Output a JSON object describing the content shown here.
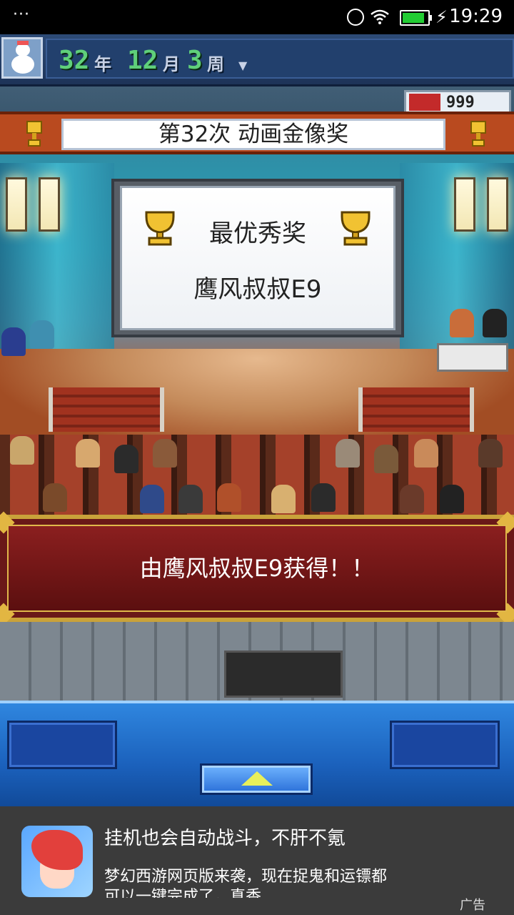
{
  "status_bar": {
    "notification": "···",
    "time": "19:29"
  },
  "hud": {
    "year": "32",
    "year_unit": "年",
    "month": "12",
    "month_unit": "月",
    "week": "3",
    "week_unit": "周",
    "score": "999"
  },
  "banner": {
    "title": "第32次 动画金像奖"
  },
  "screen": {
    "award": "最优秀奖",
    "winner": "鹰风叔叔E9"
  },
  "message": {
    "text": "由鹰风叔叔E9获得！！"
  },
  "ad": {
    "title": "挂机也会自动战斗，不肝不氪",
    "desc_line1": "梦幻西游网页版来袭，现在捉鬼和运镖都",
    "desc_line2": "可以一键完成了，真香",
    "badge": "广告"
  },
  "colors": {
    "banner": "#b94a1f",
    "message_bg": "#8b1f1f",
    "control_bar": "#1b61bc",
    "date_digits": "#5fd07a"
  }
}
